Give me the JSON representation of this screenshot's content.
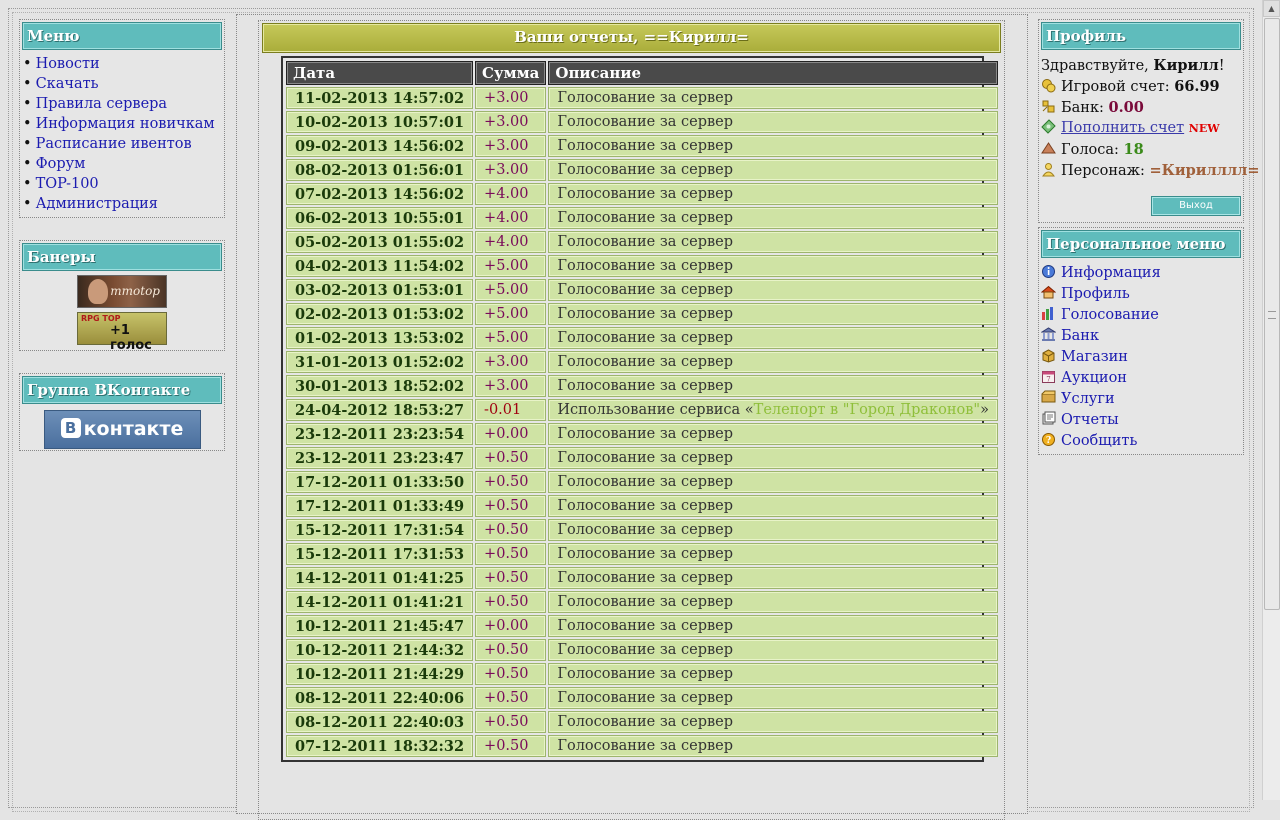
{
  "left": {
    "menu": {
      "title": "Меню",
      "items": [
        "Новости",
        "Скачать",
        "Правила сервера",
        "Информация новичкам",
        "Расписание ивентов",
        "Форум",
        "TOP-100",
        "Администрация"
      ]
    },
    "banners": {
      "title": "Банеры",
      "b1_text": "mmotop",
      "b2_small": "RPG TOP",
      "b2_text": "+1 голос"
    },
    "vk": {
      "title": "Группа ВКонтакте",
      "logo_letter": "В",
      "logo_text": "контакте"
    }
  },
  "reports": {
    "title": "Ваши отчеты, ==Кирилл=",
    "columns": [
      "Дата",
      "Сумма",
      "Описание"
    ],
    "rows": [
      {
        "date": "11-02-2013 14:57:02",
        "sum": "+3.00",
        "desc": "Голосование за сервер"
      },
      {
        "date": "10-02-2013 10:57:01",
        "sum": "+3.00",
        "desc": "Голосование за сервер"
      },
      {
        "date": "09-02-2013 14:56:02",
        "sum": "+3.00",
        "desc": "Голосование за сервер"
      },
      {
        "date": "08-02-2013 01:56:01",
        "sum": "+3.00",
        "desc": "Голосование за сервер"
      },
      {
        "date": "07-02-2013 14:56:02",
        "sum": "+4.00",
        "desc": "Голосование за сервер"
      },
      {
        "date": "06-02-2013 10:55:01",
        "sum": "+4.00",
        "desc": "Голосование за сервер"
      },
      {
        "date": "05-02-2013 01:55:02",
        "sum": "+4.00",
        "desc": "Голосование за сервер"
      },
      {
        "date": "04-02-2013 11:54:02",
        "sum": "+5.00",
        "desc": "Голосование за сервер"
      },
      {
        "date": "03-02-2013 01:53:01",
        "sum": "+5.00",
        "desc": "Голосование за сервер"
      },
      {
        "date": "02-02-2013 01:53:02",
        "sum": "+5.00",
        "desc": "Голосование за сервер"
      },
      {
        "date": "01-02-2013 13:53:02",
        "sum": "+5.00",
        "desc": "Голосование за сервер"
      },
      {
        "date": "31-01-2013 01:52:02",
        "sum": "+3.00",
        "desc": "Голосование за сервер"
      },
      {
        "date": "30-01-2013 18:52:02",
        "sum": "+3.00",
        "desc": "Голосование за сервер"
      },
      {
        "date": "24-04-2012 18:53:27",
        "sum": "-0.01",
        "desc": "Использование сервиса «",
        "link": "Телепорт в \"Город Драконов\"",
        "desc_after": "»",
        "neg": true
      },
      {
        "date": "23-12-2011 23:23:54",
        "sum": "+0.00",
        "desc": "Голосование за сервер"
      },
      {
        "date": "23-12-2011 23:23:47",
        "sum": "+0.50",
        "desc": "Голосование за сервер"
      },
      {
        "date": "17-12-2011 01:33:50",
        "sum": "+0.50",
        "desc": "Голосование за сервер"
      },
      {
        "date": "17-12-2011 01:33:49",
        "sum": "+0.50",
        "desc": "Голосование за сервер"
      },
      {
        "date": "15-12-2011 17:31:54",
        "sum": "+0.50",
        "desc": "Голосование за сервер"
      },
      {
        "date": "15-12-2011 17:31:53",
        "sum": "+0.50",
        "desc": "Голосование за сервер"
      },
      {
        "date": "14-12-2011 01:41:25",
        "sum": "+0.50",
        "desc": "Голосование за сервер"
      },
      {
        "date": "14-12-2011 01:41:21",
        "sum": "+0.50",
        "desc": "Голосование за сервер"
      },
      {
        "date": "10-12-2011 21:45:47",
        "sum": "+0.00",
        "desc": "Голосование за сервер"
      },
      {
        "date": "10-12-2011 21:44:32",
        "sum": "+0.50",
        "desc": "Голосование за сервер"
      },
      {
        "date": "10-12-2011 21:44:29",
        "sum": "+0.50",
        "desc": "Голосование за сервер"
      },
      {
        "date": "08-12-2011 22:40:06",
        "sum": "+0.50",
        "desc": "Голосование за сервер"
      },
      {
        "date": "08-12-2011 22:40:03",
        "sum": "+0.50",
        "desc": "Голосование за сервер"
      },
      {
        "date": "07-12-2011 18:32:32",
        "sum": "+0.50",
        "desc": "Голосование за сервер"
      }
    ]
  },
  "profile": {
    "title": "Профиль",
    "greeting": "Здравствуйте,",
    "username": "Кирилл",
    "greeting_end": "!",
    "balance_label": "Игровой счет:",
    "balance": "66.99",
    "bank_label": "Банк:",
    "bank": "0.00",
    "topup": "Пополнить счет",
    "new_badge": "NEW",
    "votes_label": "Голоса:",
    "votes": "18",
    "char_label": "Персонаж:",
    "char": "=Кирилллл=",
    "exit": "Выход"
  },
  "personal_menu": {
    "title": "Персональное меню",
    "items": [
      {
        "label": "Информация",
        "icon": "info-icon"
      },
      {
        "label": "Профиль",
        "icon": "house-icon"
      },
      {
        "label": "Голосование",
        "icon": "bar-chart-icon"
      },
      {
        "label": "Банк",
        "icon": "bank-icon"
      },
      {
        "label": "Магазин",
        "icon": "box-icon"
      },
      {
        "label": "Аукцион",
        "icon": "calendar-icon"
      },
      {
        "label": "Услуги",
        "icon": "package-icon"
      },
      {
        "label": "Отчеты",
        "icon": "report-icon"
      },
      {
        "label": "Сообщить",
        "icon": "help-icon"
      }
    ]
  },
  "colors": {
    "teal": "#5fbcbc",
    "olive": "#aab03e",
    "row": "#cfe3a4",
    "link": "#1b1bb0"
  }
}
